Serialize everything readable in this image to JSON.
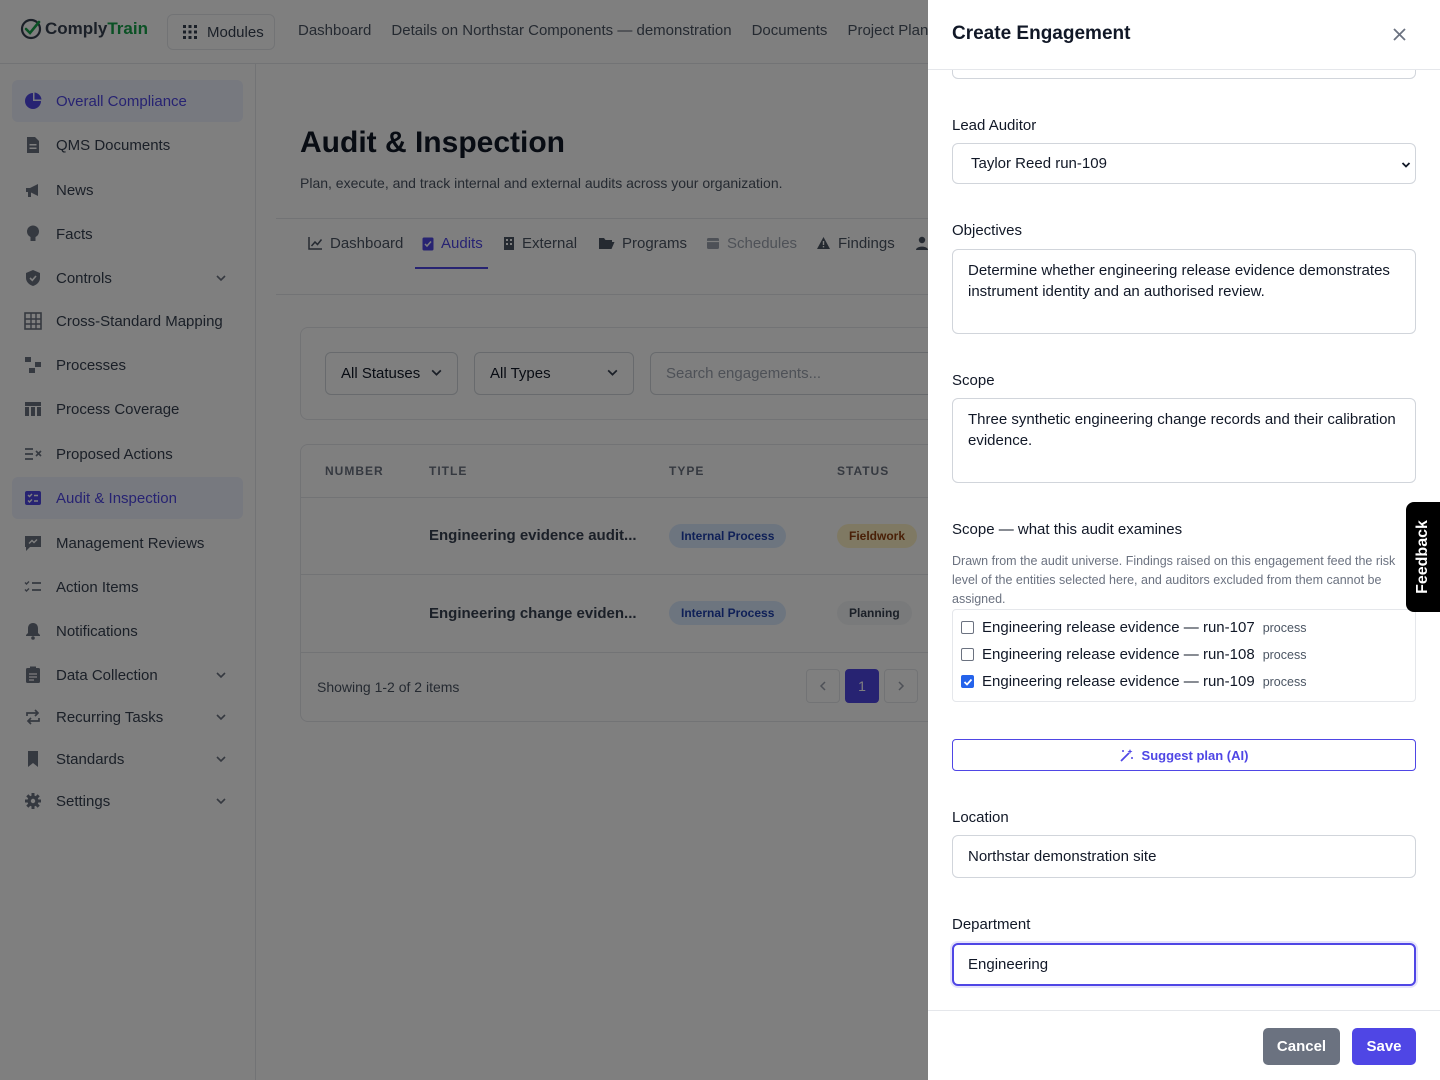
{
  "app": {
    "logo_part1": "Comply",
    "logo_part2": "Train",
    "modules_label": "Modules",
    "topnav": [
      "Dashboard",
      "Details on Northstar Components — demonstration",
      "Documents",
      "Project Planni"
    ]
  },
  "sidebar": {
    "items": [
      {
        "label": "Overall Compliance",
        "icon": "pie-chart-icon"
      },
      {
        "label": "QMS Documents",
        "icon": "document-icon"
      },
      {
        "label": "News",
        "icon": "megaphone-icon"
      },
      {
        "label": "Facts",
        "icon": "lightbulb-icon"
      },
      {
        "label": "Controls",
        "icon": "shield-icon"
      },
      {
        "label": "Cross-Standard Mapping",
        "icon": "grid-icon"
      },
      {
        "label": "Processes",
        "icon": "flow-icon"
      },
      {
        "label": "Process Coverage",
        "icon": "table-icon"
      },
      {
        "label": "Proposed Actions",
        "icon": "list-x-icon"
      },
      {
        "label": "Audit & Inspection",
        "icon": "checklist-icon"
      },
      {
        "label": "Management Reviews",
        "icon": "chat-icon"
      },
      {
        "label": "Action Items",
        "icon": "list-check-icon"
      },
      {
        "label": "Notifications",
        "icon": "bell-icon"
      },
      {
        "label": "Data Collection",
        "icon": "clipboard-icon"
      },
      {
        "label": "Recurring Tasks",
        "icon": "repeat-icon"
      },
      {
        "label": "Standards",
        "icon": "bookmark-icon"
      },
      {
        "label": "Settings",
        "icon": "gear-icon"
      }
    ]
  },
  "main": {
    "title": "Audit & Inspection",
    "subtitle": "Plan, execute, and track internal and external audits across your organization.",
    "tabs": [
      {
        "label": "Dashboard"
      },
      {
        "label": "Audits"
      },
      {
        "label": "External"
      },
      {
        "label": "Programs"
      },
      {
        "label": "Schedules"
      },
      {
        "label": "Findings"
      }
    ],
    "filters": {
      "status": "All Statuses",
      "type": "All Types",
      "search_placeholder": "Search engagements..."
    },
    "table": {
      "columns": [
        "NUMBER",
        "TITLE",
        "TYPE",
        "STATUS"
      ],
      "rows": [
        {
          "title": "Engineering evidence audit...",
          "type": "Internal Process",
          "status": "Fieldwork"
        },
        {
          "title": "Engineering change eviden...",
          "type": "Internal Process",
          "status": "Planning"
        }
      ]
    },
    "showing": "Showing 1-2 of 2 items",
    "page": "1"
  },
  "drawer": {
    "title": "Create Engagement",
    "lead_auditor_label": "Lead Auditor",
    "lead_auditor_value": "Taylor Reed run-109",
    "objectives_label": "Objectives",
    "objectives_value": "Determine whether engineering release evidence demonstrates instrument identity and an authorised review.",
    "scope_label": "Scope",
    "scope_value": "Three synthetic engineering change records and their calibration evidence.",
    "scope_section_label": "Scope — what this audit examines",
    "scope_help": "Drawn from the audit universe. Findings raised on this engagement feed the risk level of the entities selected here, and auditors excluded from them cannot be assigned.",
    "scope_options": [
      {
        "label": "Engineering release evidence — run-107",
        "tag": "process",
        "checked": false
      },
      {
        "label": "Engineering release evidence — run-108",
        "tag": "process",
        "checked": false
      },
      {
        "label": "Engineering release evidence — run-109",
        "tag": "process",
        "checked": true
      }
    ],
    "suggest_label": "Suggest plan (AI)",
    "location_label": "Location",
    "location_value": "Northstar demonstration site",
    "department_label": "Department",
    "department_value": "Engineering",
    "cancel_label": "Cancel",
    "save_label": "Save"
  },
  "feedback_label": "Feedback",
  "colors": {
    "accent": "#4f46e5",
    "brand_green": "#16a34a",
    "overlay": "rgba(0,0,0,0.5)"
  }
}
